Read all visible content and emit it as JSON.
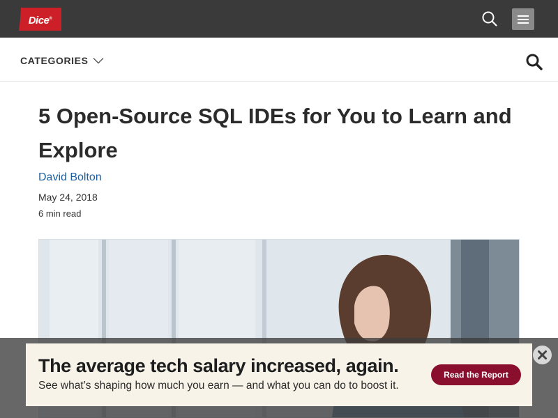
{
  "header": {
    "logo_text": "Dice",
    "logo_mark": "®",
    "search_icon": "search-icon",
    "menu_icon": "hamburger-menu-icon"
  },
  "categories_bar": {
    "label": "CATEGORIES",
    "chevron_icon": "chevron-down-icon",
    "search_icon": "search-icon"
  },
  "article": {
    "title": "5 Open-Source SQL IDEs for You to Learn and Explore",
    "author": "David Bolton",
    "date": "May 24, 2018",
    "read_time": "6 min read",
    "hero_image": "photo of a woman working at a laptop near a window"
  },
  "ad": {
    "headline": "The average tech salary increased, again.",
    "subtext": "See what’s shaping how much you earn — and what you can do to boost it.",
    "button_label": "Read the Report",
    "close_icon": "close-icon"
  },
  "colors": {
    "topbar_bg": "#3a3a3a",
    "logo_red": "#cc1f27",
    "author_link": "#1d5fa0",
    "ad_background": "#f7f3e8",
    "ad_button": "#8a0f2e"
  }
}
